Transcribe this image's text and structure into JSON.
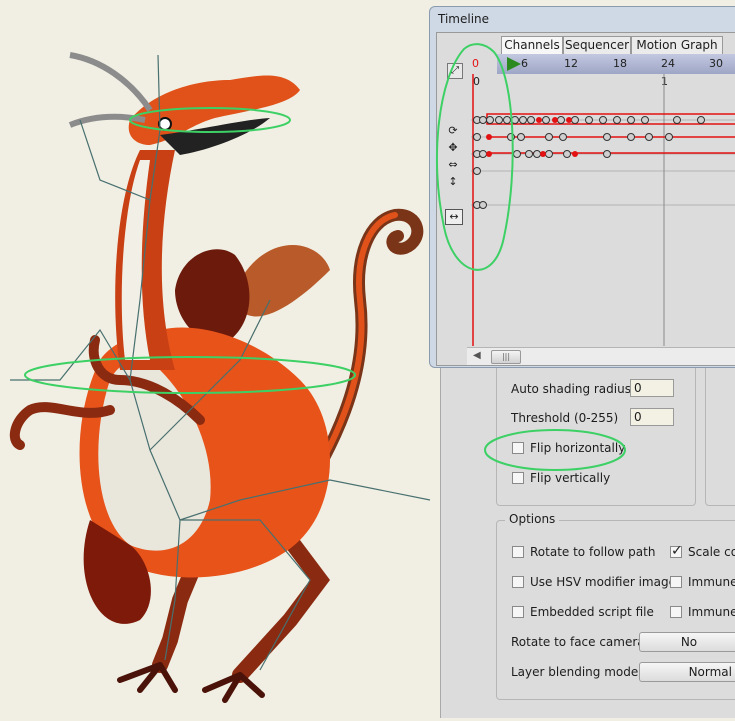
{
  "timeline": {
    "title": "Timeline",
    "tabs": [
      "Channels",
      "Sequencer",
      "Motion Graph"
    ],
    "ruler_ticks": [
      "0",
      "6",
      "12",
      "18",
      "24",
      "30"
    ],
    "row_marker": "0",
    "second_marker": "1",
    "channel_icons": [
      "bone-rotate-icon",
      "bone-translate-icon",
      "bone-scale-icon",
      "bone-stretch-icon",
      "layer-flip-icon"
    ],
    "current_frame": 0,
    "accent": "#e31212",
    "play_color": "#2a8a1f"
  },
  "properties": {
    "auto_shading_radius_label": "Auto shading radius",
    "auto_shading_radius_value": "0",
    "threshold_label": "Threshold (0-255)",
    "threshold_value": "0",
    "flip_horizontally_label": "Flip horizontally",
    "flip_horizontally_checked": false,
    "flip_vertically_label": "Flip vertically",
    "flip_vertically_checked": false
  },
  "options": {
    "title": "Options",
    "rotate_follow_path_label": "Rotate to follow path",
    "scale_comp_label": "Scale com",
    "scale_comp_checked": true,
    "use_hsv_label": "Use HSV modifier image",
    "immune1_label": "Immune",
    "embedded_script_label": "Embedded script file",
    "immune2_label": "Immune",
    "rotate_face_camera_label": "Rotate to face camera",
    "rotate_face_camera_value": "No",
    "layer_blending_label": "Layer blending mode",
    "layer_blending_value": "Normal"
  }
}
